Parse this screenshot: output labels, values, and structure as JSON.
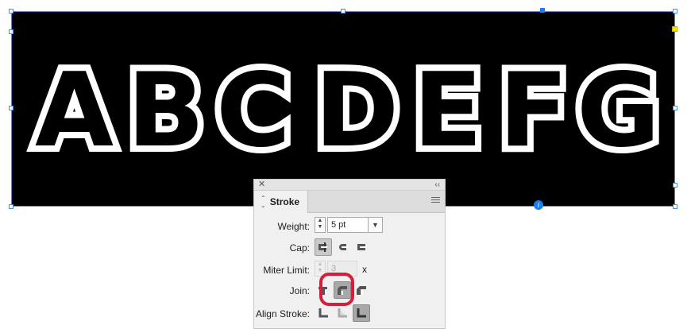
{
  "artwork": {
    "letters": [
      "A",
      "B",
      "C",
      "D",
      "E",
      "F",
      "G"
    ]
  },
  "stroke_panel": {
    "title": "Stroke",
    "weight": {
      "label": "Weight:",
      "value": "5 pt"
    },
    "cap": {
      "label": "Cap:",
      "options": [
        "butt-cap-icon",
        "round-cap-icon",
        "projecting-cap-icon"
      ],
      "selected": 0
    },
    "miter_limit": {
      "label": "Miter Limit:",
      "value": "3",
      "unit": "x"
    },
    "join": {
      "label": "Join:",
      "options": [
        "miter-join-icon",
        "round-join-icon",
        "bevel-join-icon"
      ],
      "selected": 1
    },
    "align_stroke": {
      "label": "Align Stroke:",
      "options": [
        "align-center-icon",
        "align-inside-icon",
        "align-outside-icon"
      ],
      "selected": 2
    }
  },
  "colors": {
    "selection": "#1b7ef0",
    "highlight": "#d41f3a",
    "artboard": "#000000"
  }
}
